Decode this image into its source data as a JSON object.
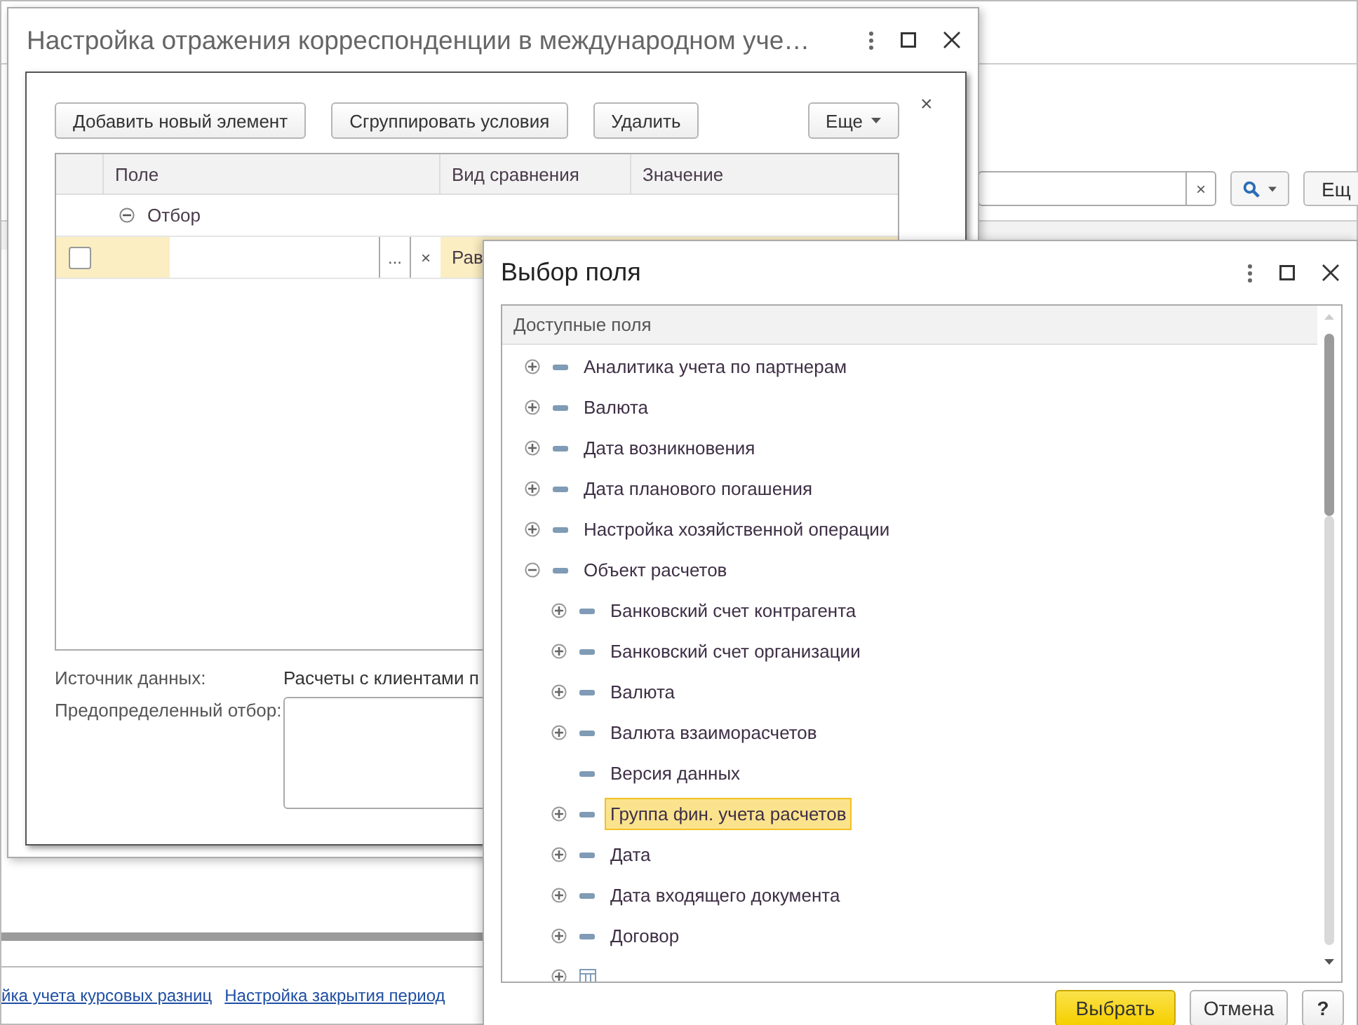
{
  "background_app": {
    "search": {
      "clear": "×"
    },
    "more_button": "Ещ",
    "links": [
      {
        "text": "йка учета курсовых разниц"
      },
      {
        "text": "Настройка закрытия период"
      }
    ]
  },
  "settings_window": {
    "title": "Настройка отражения корреспонденции в международном уче…",
    "filter_panel": {
      "toolbar": [
        "Добавить новый элемент",
        "Сгруппировать условия",
        "Удалить"
      ],
      "more_button": "Еще",
      "close": "×",
      "columns": [
        "Поле",
        "Вид сравнения",
        "Значение"
      ],
      "rows": [
        {
          "kind": "group",
          "label": "Отбор",
          "expanded": true,
          "selected": false
        },
        {
          "kind": "condition",
          "checked": false,
          "selection": "...",
          "clear": "×",
          "comparison": "Рав",
          "selected": true
        }
      ],
      "data_source_label": "Источник данных:",
      "data_source": "Расчеты с клиентами п",
      "predefined_filter_label": "Предопределенный отбор:"
    }
  },
  "field_dialog": {
    "title": "Выбор поля",
    "column": "Доступные поля",
    "tree": [
      {
        "label": "Аналитика учета по партнерам",
        "kind": "field",
        "expandable": true,
        "expanded": false,
        "selected": false
      },
      {
        "label": "Валюта",
        "kind": "field",
        "expandable": true,
        "expanded": false,
        "selected": false
      },
      {
        "label": "Дата возникновения",
        "kind": "field",
        "expandable": true,
        "expanded": false,
        "selected": false
      },
      {
        "label": "Дата планового погашения",
        "kind": "field",
        "expandable": true,
        "expanded": false,
        "selected": false
      },
      {
        "label": "Настройка хозяйственной операции",
        "kind": "field",
        "expandable": true,
        "expanded": false,
        "selected": false
      },
      {
        "label": "Объект расчетов",
        "kind": "field",
        "expandable": true,
        "expanded": true,
        "selected": false,
        "children": [
          {
            "label": "Банковский счет контрагента",
            "kind": "field",
            "expandable": true,
            "expanded": false,
            "selected": false
          },
          {
            "label": "Банковский счет организации",
            "kind": "field",
            "expandable": true,
            "expanded": false,
            "selected": false
          },
          {
            "label": "Валюта",
            "kind": "field",
            "expandable": true,
            "expanded": false,
            "selected": false
          },
          {
            "label": "Валюта взаиморасчетов",
            "kind": "field",
            "expandable": true,
            "expanded": false,
            "selected": false
          },
          {
            "label": "Версия данных",
            "kind": "field",
            "expandable": false,
            "selected": false
          },
          {
            "label": "Группа фин. учета расчетов",
            "kind": "field",
            "expandable": true,
            "expanded": false,
            "selected": true
          },
          {
            "label": "Дата",
            "kind": "field",
            "expandable": true,
            "expanded": false,
            "selected": false
          },
          {
            "label": "Дата входящего документа",
            "kind": "field",
            "expandable": true,
            "expanded": false,
            "selected": false
          },
          {
            "label": "Договор",
            "kind": "field",
            "expandable": true,
            "expanded": false,
            "selected": false
          },
          {
            "kind": "table",
            "expandable": true,
            "expanded": false
          }
        ]
      }
    ],
    "buttons": [
      {
        "label": "Выбрать",
        "kind": "default"
      },
      {
        "label": "Отмена",
        "kind": "normal"
      },
      {
        "label": "?",
        "kind": "help"
      }
    ]
  }
}
